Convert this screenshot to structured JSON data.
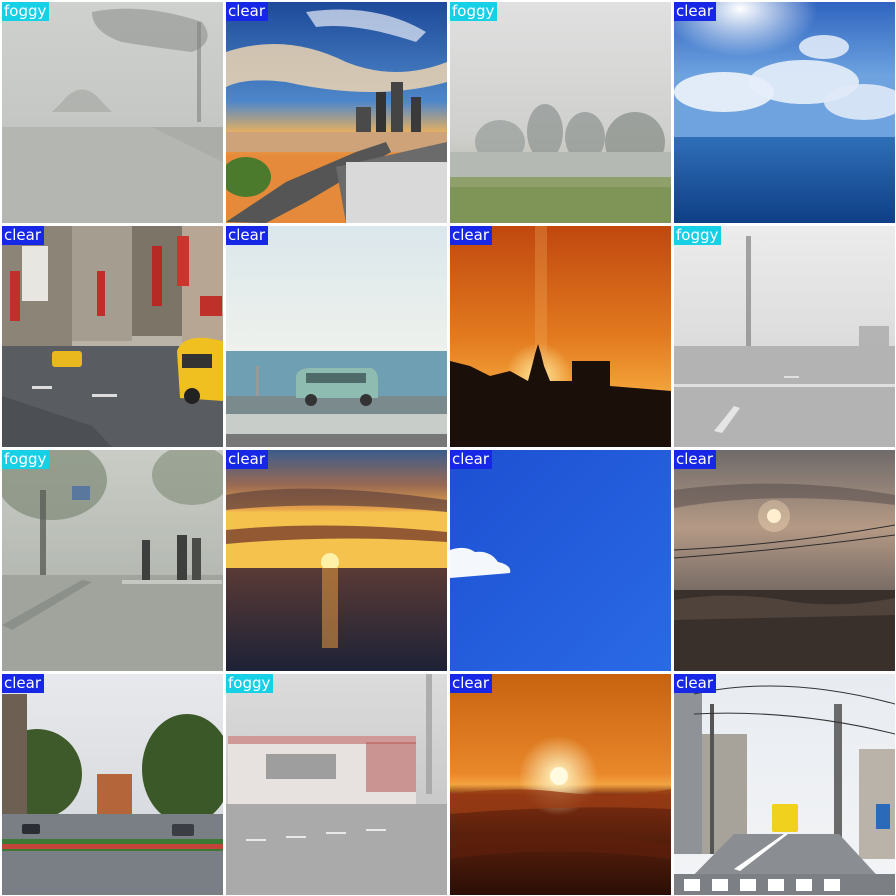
{
  "grid": {
    "rows": 4,
    "columns": 4,
    "colors": {
      "clear": "#1727e6",
      "foggy": "#16d0e6"
    },
    "tiles": [
      {
        "label": "foggy",
        "scene": "foggy-street-trees"
      },
      {
        "label": "clear",
        "scene": "city-skyline-sunset"
      },
      {
        "label": "foggy",
        "scene": "foggy-field-trees"
      },
      {
        "label": "clear",
        "scene": "ocean-sun-clouds"
      },
      {
        "label": "clear",
        "scene": "chinatown-street-taxi"
      },
      {
        "label": "clear",
        "scene": "seaside-van"
      },
      {
        "label": "clear",
        "scene": "sunset-silhouette-church"
      },
      {
        "label": "foggy",
        "scene": "foggy-road-pole"
      },
      {
        "label": "foggy",
        "scene": "foggy-crosswalk-people"
      },
      {
        "label": "clear",
        "scene": "sunset-over-sea"
      },
      {
        "label": "clear",
        "scene": "blue-sky-cloud"
      },
      {
        "label": "clear",
        "scene": "hazy-sun-powerlines"
      },
      {
        "label": "clear",
        "scene": "boulevard-trees"
      },
      {
        "label": "foggy",
        "scene": "foggy-tram"
      },
      {
        "label": "clear",
        "scene": "sunrise-above-clouds"
      },
      {
        "label": "clear",
        "scene": "japanese-street-bus"
      }
    ]
  }
}
